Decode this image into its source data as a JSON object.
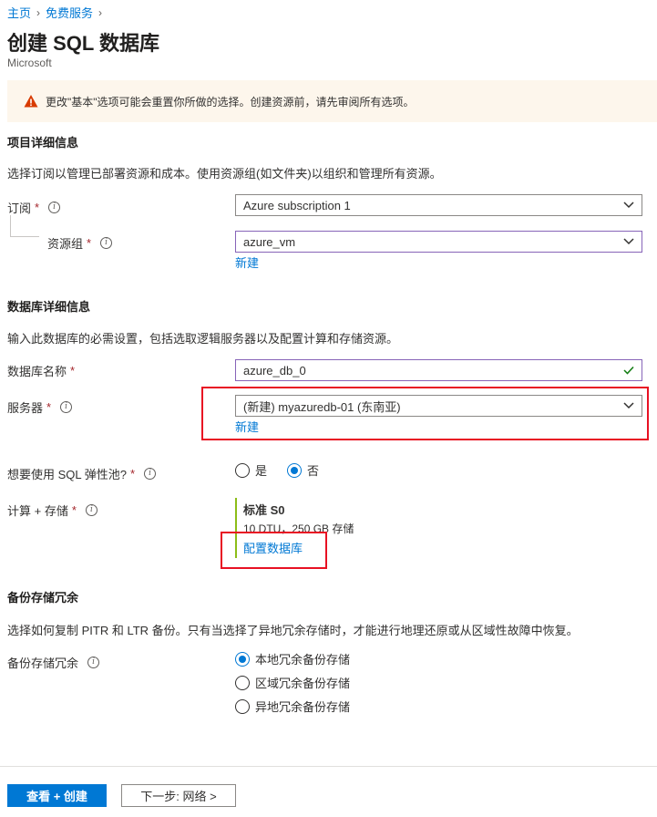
{
  "breadcrumb": {
    "home": "主页",
    "free_services": "免费服务"
  },
  "header": {
    "title": "创建 SQL 数据库",
    "publisher": "Microsoft"
  },
  "warning": {
    "text": "更改\"基本\"选项可能会重置你所做的选择。创建资源前，请先审阅所有选项。"
  },
  "project": {
    "section_title": "项目详细信息",
    "description": "选择订阅以管理已部署资源和成本。使用资源组(如文件夹)以组织和管理所有资源。",
    "subscription": {
      "label": "订阅",
      "required": "*",
      "value": "Azure subscription 1"
    },
    "resource_group": {
      "label": "资源组",
      "required": "*",
      "value": "azure_vm",
      "create_new": "新建"
    }
  },
  "database": {
    "section_title": "数据库详细信息",
    "description": "输入此数据库的必需设置，包括选取逻辑服务器以及配置计算和存储资源。",
    "name": {
      "label": "数据库名称",
      "required": "*",
      "value": "azure_db_0"
    },
    "server": {
      "label": "服务器",
      "required": "*",
      "value": "(新建) myazuredb-01 (东南亚)",
      "create_new": "新建"
    },
    "elastic_pool": {
      "label": "想要使用 SQL 弹性池?",
      "required": "*",
      "options": [
        "是",
        "否"
      ],
      "selected": "否"
    },
    "compute": {
      "label": "计算 + 存储",
      "required": "*",
      "tier": "标准 S0",
      "details": "10 DTU，250 GB 存储",
      "configure": "配置数据库"
    }
  },
  "backup": {
    "section_title": "备份存储冗余",
    "description": "选择如何复制 PITR 和 LTR 备份。只有当选择了异地冗余存储时，才能进行地理还原或从区域性故障中恢复。",
    "label": "备份存储冗余",
    "options": [
      "本地冗余备份存储",
      "区域冗余备份存储",
      "异地冗余备份存储"
    ],
    "selected": "本地冗余备份存储"
  },
  "footer": {
    "review_create": "查看 + 创建",
    "next": "下一步: 网络 >"
  },
  "colors": {
    "accent": "#0078d4",
    "required": "#a4262c",
    "highlight": "#e81123",
    "valid": "#107c10",
    "tier_bar": "#8cbd18"
  }
}
